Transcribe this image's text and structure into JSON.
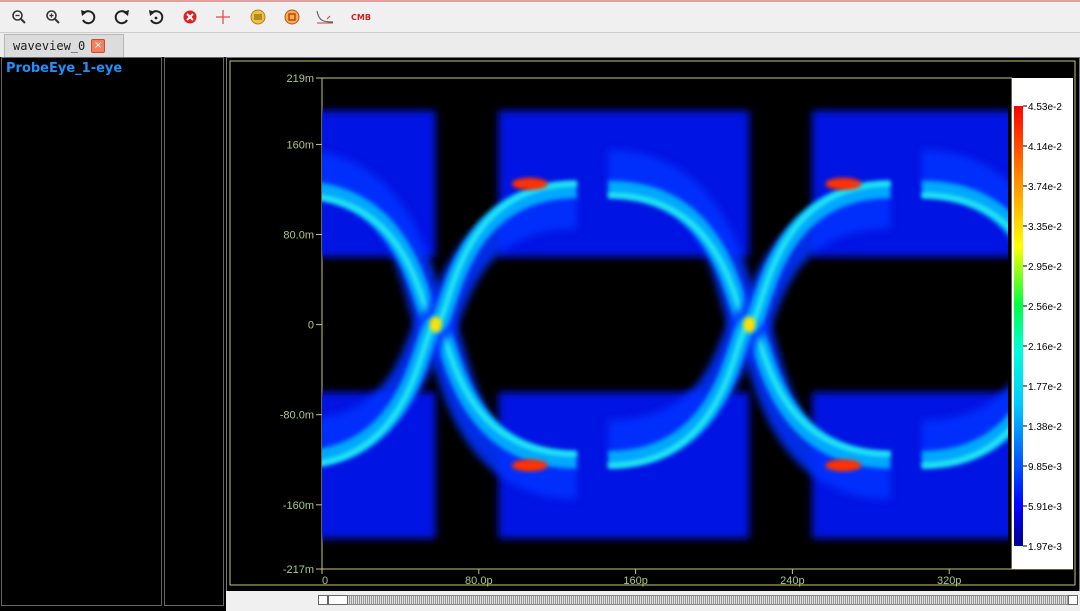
{
  "toolbar": {
    "items": [
      {
        "name": "zoom-out-icon"
      },
      {
        "name": "zoom-in-icon"
      },
      {
        "name": "undo-icon"
      },
      {
        "name": "redo-icon"
      },
      {
        "name": "reset-icon"
      },
      {
        "name": "delete-icon"
      },
      {
        "name": "cursor-icon"
      },
      {
        "name": "measure-icon"
      },
      {
        "name": "marker-icon"
      },
      {
        "name": "curve-icon"
      },
      {
        "name": "cmb-icon",
        "label": "CMB"
      }
    ]
  },
  "tabs": [
    {
      "label": "waveview_0",
      "close": "×"
    }
  ],
  "signal": {
    "name": "ProbeEye_1-eye"
  },
  "plot": {
    "y_ticks": [
      "219m",
      "160m",
      "80.0m",
      "0",
      "-80.0m",
      "-160m",
      "-217m"
    ],
    "x_ticks": [
      "0",
      "80.0p",
      "160p",
      "240p",
      "320p"
    ],
    "colorbar_ticks": [
      "4.53e-2",
      "4.14e-2",
      "3.74e-2",
      "3.35e-2",
      "2.95e-2",
      "2.56e-2",
      "2.16e-2",
      "1.77e-2",
      "1.38e-2",
      "9.85e-3",
      "5.91e-3",
      "1.97e-3"
    ]
  },
  "chart_data": {
    "type": "heatmap",
    "title": "",
    "xlabel": "",
    "ylabel": "",
    "x_unit": "s",
    "y_unit": "V",
    "xlim": [
      0,
      3.5e-13
    ],
    "ylim": [
      -0.217,
      0.219
    ],
    "unit_interval": 1.6e-13,
    "eye_crossings_x": [
      5.8e-14,
      2.18e-13
    ],
    "high_level": 0.12,
    "low_level": -0.12,
    "color_range": [
      0.00197,
      0.0453
    ],
    "colors": {
      "background": "#000000",
      "axis": "#c8c870",
      "tick_text": "#a8c880",
      "colorbar_text": "#000000"
    }
  }
}
